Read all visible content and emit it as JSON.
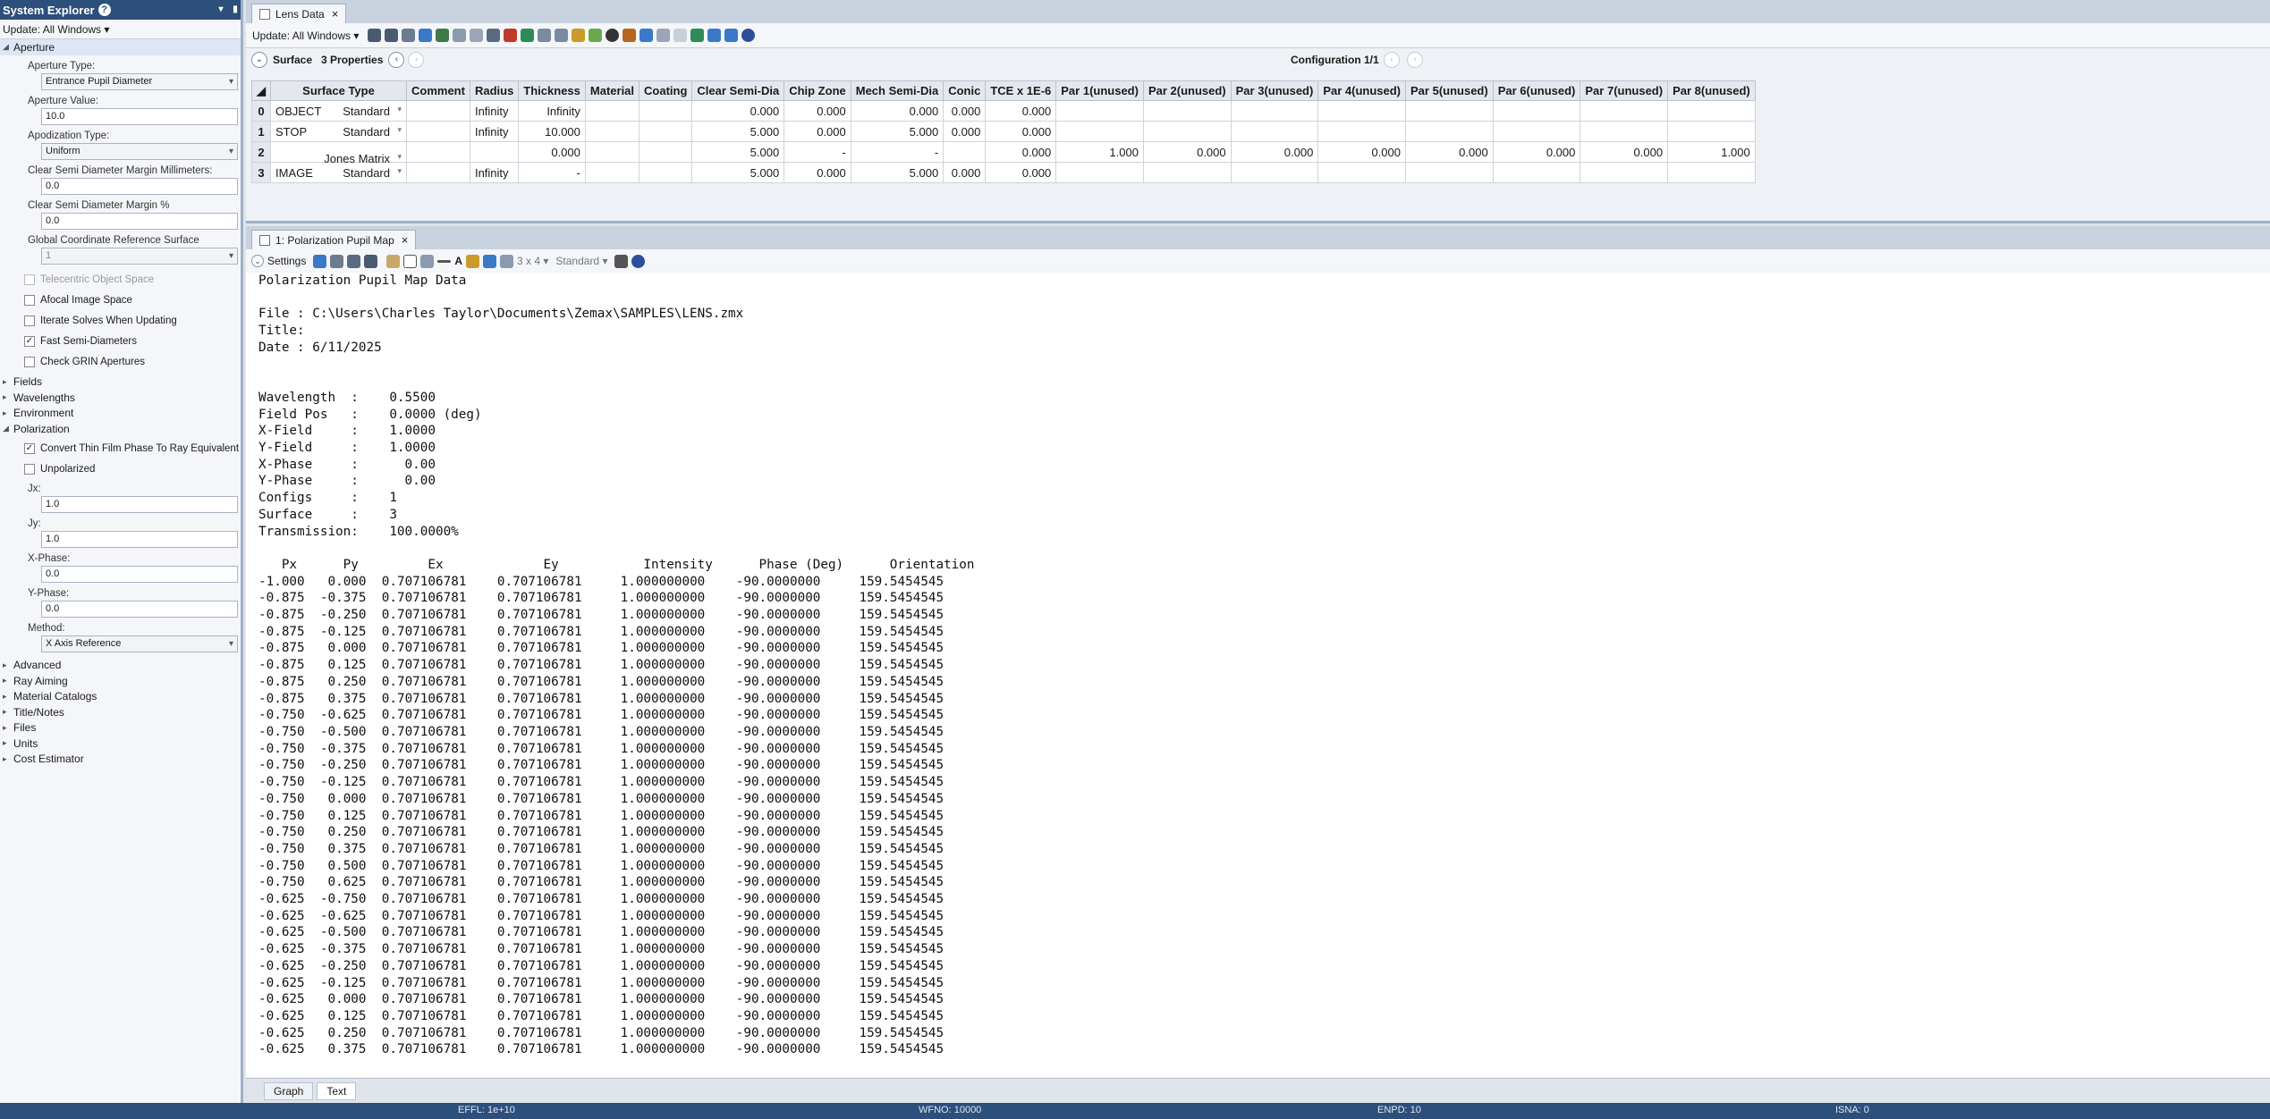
{
  "system_explorer": {
    "title": "System Explorer",
    "help_glyph": "?",
    "update_label": "Update: All Windows",
    "aperture": {
      "label": "Aperture",
      "aperture_type_label": "Aperture Type:",
      "aperture_type_value": "Entrance Pupil Diameter",
      "aperture_value_label": "Aperture Value:",
      "aperture_value": "10.0",
      "apodization_label": "Apodization Type:",
      "apodization_value": "Uniform",
      "csd_margin_mm_label": "Clear Semi Diameter Margin Millimeters:",
      "csd_margin_mm_value": "0.0",
      "csd_margin_pct_label": "Clear Semi Diameter Margin %",
      "csd_margin_pct_value": "0.0",
      "gcrs_label": "Global Coordinate Reference Surface",
      "gcrs_value": "1",
      "telecentric_label": "Telecentric Object Space",
      "afocal_label": "Afocal Image Space",
      "iterate_label": "Iterate Solves When Updating",
      "fast_semi_label": "Fast Semi-Diameters",
      "check_grin_label": "Check GRIN Apertures"
    },
    "sections_before_pol": [
      "Fields",
      "Wavelengths",
      "Environment"
    ],
    "polarization": {
      "label": "Polarization",
      "convert_label": "Convert Thin Film Phase To Ray Equivalent",
      "unpolarized_label": "Unpolarized",
      "jx_label": "Jx:",
      "jx_value": "1.0",
      "jy_label": "Jy:",
      "jy_value": "1.0",
      "xphase_label": "X-Phase:",
      "xphase_value": "0.0",
      "yphase_label": "Y-Phase:",
      "yphase_value": "0.0",
      "method_label": "Method:",
      "method_value": "X Axis Reference"
    },
    "sections_after_pol": [
      "Advanced",
      "Ray Aiming",
      "Material Catalogs",
      "Title/Notes",
      "Files",
      "Units",
      "Cost Estimator"
    ]
  },
  "lens_data": {
    "tab_label": "Lens Data",
    "update_label": "Update: All Windows",
    "surface_label": "Surface",
    "properties_label": "3 Properties",
    "configuration_label": "Configuration 1/1",
    "columns": [
      "Surface Type",
      "Comment",
      "Radius",
      "Thickness",
      "Material",
      "Coating",
      "Clear Semi-Dia",
      "Chip Zone",
      "Mech Semi-Dia",
      "Conic",
      "TCE x 1E-6",
      "Par 1(unused)",
      "Par 2(unused)",
      "Par 3(unused)",
      "Par 4(unused)",
      "Par 5(unused)",
      "Par 6(unused)",
      "Par 7(unused)",
      "Par 8(unused)"
    ],
    "rows": [
      {
        "idx": "0",
        "name": "OBJECT",
        "type": "Standard",
        "comment": "",
        "radius": "Infinity",
        "thickness": "Infinity",
        "material": "",
        "coating": "",
        "csd": "0.000",
        "chip": "0.000",
        "msd": "0.000",
        "conic": "0.000",
        "tce": "0.000",
        "pars": [
          "",
          "",
          "",
          "",
          "",
          "",
          "",
          ""
        ]
      },
      {
        "idx": "1",
        "name": "STOP",
        "type": "Standard",
        "comment": "",
        "radius": "Infinity",
        "thickness": "10.000",
        "material": "",
        "coating": "",
        "csd": "5.000",
        "chip": "0.000",
        "msd": "5.000",
        "conic": "0.000",
        "tce": "0.000",
        "pars": [
          "",
          "",
          "",
          "",
          "",
          "",
          "",
          ""
        ]
      },
      {
        "idx": "2",
        "name": "",
        "type": "Jones Matrix",
        "comment": "",
        "radius": "",
        "thickness": "0.000",
        "material": "",
        "coating": "",
        "csd": "5.000",
        "chip": "-",
        "msd": "-",
        "conic": "",
        "tce": "0.000",
        "pars": [
          "1.000",
          "0.000",
          "0.000",
          "0.000",
          "0.000",
          "0.000",
          "0.000",
          "1.000"
        ]
      },
      {
        "idx": "3",
        "name": "IMAGE",
        "type": "Standard",
        "comment": "",
        "radius": "Infinity",
        "thickness": "-",
        "material": "",
        "coating": "",
        "csd": "5.000",
        "chip": "0.000",
        "msd": "5.000",
        "conic": "0.000",
        "tce": "0.000",
        "pars": [
          "",
          "",
          "",
          "",
          "",
          "",
          "",
          ""
        ]
      }
    ]
  },
  "pol_map": {
    "tab_label": "1: Polarization Pupil Map",
    "settings_label": "Settings",
    "grid_label": "3 x 4",
    "style_label": "Standard",
    "header_lines": [
      "Polarization Pupil Map Data",
      "",
      "File : C:\\Users\\Charles Taylor\\Documents\\Zemax\\SAMPLES\\LENS.zmx",
      "Title:",
      "Date : 6/11/2025",
      "",
      "",
      "Wavelength  :    0.5500",
      "Field Pos   :    0.0000 (deg)",
      "X-Field     :    1.0000",
      "Y-Field     :    1.0000",
      "X-Phase     :      0.00",
      "Y-Phase     :      0.00",
      "Configs     :    1",
      "Surface     :    3",
      "Transmission:    100.0000%",
      ""
    ],
    "column_header": "   Px      Py         Ex             Ey           Intensity      Phase (Deg)      Orientation",
    "rows": [
      [
        "-1.000",
        "0.000",
        "0.707106781",
        "0.707106781",
        "1.000000000",
        "-90.0000000",
        "159.5454545"
      ],
      [
        "-0.875",
        "-0.375",
        "0.707106781",
        "0.707106781",
        "1.000000000",
        "-90.0000000",
        "159.5454545"
      ],
      [
        "-0.875",
        "-0.250",
        "0.707106781",
        "0.707106781",
        "1.000000000",
        "-90.0000000",
        "159.5454545"
      ],
      [
        "-0.875",
        "-0.125",
        "0.707106781",
        "0.707106781",
        "1.000000000",
        "-90.0000000",
        "159.5454545"
      ],
      [
        "-0.875",
        "0.000",
        "0.707106781",
        "0.707106781",
        "1.000000000",
        "-90.0000000",
        "159.5454545"
      ],
      [
        "-0.875",
        "0.125",
        "0.707106781",
        "0.707106781",
        "1.000000000",
        "-90.0000000",
        "159.5454545"
      ],
      [
        "-0.875",
        "0.250",
        "0.707106781",
        "0.707106781",
        "1.000000000",
        "-90.0000000",
        "159.5454545"
      ],
      [
        "-0.875",
        "0.375",
        "0.707106781",
        "0.707106781",
        "1.000000000",
        "-90.0000000",
        "159.5454545"
      ],
      [
        "-0.750",
        "-0.625",
        "0.707106781",
        "0.707106781",
        "1.000000000",
        "-90.0000000",
        "159.5454545"
      ],
      [
        "-0.750",
        "-0.500",
        "0.707106781",
        "0.707106781",
        "1.000000000",
        "-90.0000000",
        "159.5454545"
      ],
      [
        "-0.750",
        "-0.375",
        "0.707106781",
        "0.707106781",
        "1.000000000",
        "-90.0000000",
        "159.5454545"
      ],
      [
        "-0.750",
        "-0.250",
        "0.707106781",
        "0.707106781",
        "1.000000000",
        "-90.0000000",
        "159.5454545"
      ],
      [
        "-0.750",
        "-0.125",
        "0.707106781",
        "0.707106781",
        "1.000000000",
        "-90.0000000",
        "159.5454545"
      ],
      [
        "-0.750",
        "0.000",
        "0.707106781",
        "0.707106781",
        "1.000000000",
        "-90.0000000",
        "159.5454545"
      ],
      [
        "-0.750",
        "0.125",
        "0.707106781",
        "0.707106781",
        "1.000000000",
        "-90.0000000",
        "159.5454545"
      ],
      [
        "-0.750",
        "0.250",
        "0.707106781",
        "0.707106781",
        "1.000000000",
        "-90.0000000",
        "159.5454545"
      ],
      [
        "-0.750",
        "0.375",
        "0.707106781",
        "0.707106781",
        "1.000000000",
        "-90.0000000",
        "159.5454545"
      ],
      [
        "-0.750",
        "0.500",
        "0.707106781",
        "0.707106781",
        "1.000000000",
        "-90.0000000",
        "159.5454545"
      ],
      [
        "-0.750",
        "0.625",
        "0.707106781",
        "0.707106781",
        "1.000000000",
        "-90.0000000",
        "159.5454545"
      ],
      [
        "-0.625",
        "-0.750",
        "0.707106781",
        "0.707106781",
        "1.000000000",
        "-90.0000000",
        "159.5454545"
      ],
      [
        "-0.625",
        "-0.625",
        "0.707106781",
        "0.707106781",
        "1.000000000",
        "-90.0000000",
        "159.5454545"
      ],
      [
        "-0.625",
        "-0.500",
        "0.707106781",
        "0.707106781",
        "1.000000000",
        "-90.0000000",
        "159.5454545"
      ],
      [
        "-0.625",
        "-0.375",
        "0.707106781",
        "0.707106781",
        "1.000000000",
        "-90.0000000",
        "159.5454545"
      ],
      [
        "-0.625",
        "-0.250",
        "0.707106781",
        "0.707106781",
        "1.000000000",
        "-90.0000000",
        "159.5454545"
      ],
      [
        "-0.625",
        "-0.125",
        "0.707106781",
        "0.707106781",
        "1.000000000",
        "-90.0000000",
        "159.5454545"
      ],
      [
        "-0.625",
        "0.000",
        "0.707106781",
        "0.707106781",
        "1.000000000",
        "-90.0000000",
        "159.5454545"
      ],
      [
        "-0.625",
        "0.125",
        "0.707106781",
        "0.707106781",
        "1.000000000",
        "-90.0000000",
        "159.5454545"
      ],
      [
        "-0.625",
        "0.250",
        "0.707106781",
        "0.707106781",
        "1.000000000",
        "-90.0000000",
        "159.5454545"
      ],
      [
        "-0.625",
        "0.375",
        "0.707106781",
        "0.707106781",
        "1.000000000",
        "-90.0000000",
        "159.5454545"
      ]
    ],
    "bottom_tabs": [
      "Graph",
      "Text"
    ]
  },
  "status_bar": {
    "effl": "EFFL: 1e+10",
    "wfno": "WFNO: 10000",
    "enpd": "ENPD: 10",
    "isna": "ISNA: 0"
  },
  "colors": {
    "title_bar": "#2c4f7c",
    "status_bar": "#2c4f7c",
    "panel_bg": "#f4f6f9"
  }
}
